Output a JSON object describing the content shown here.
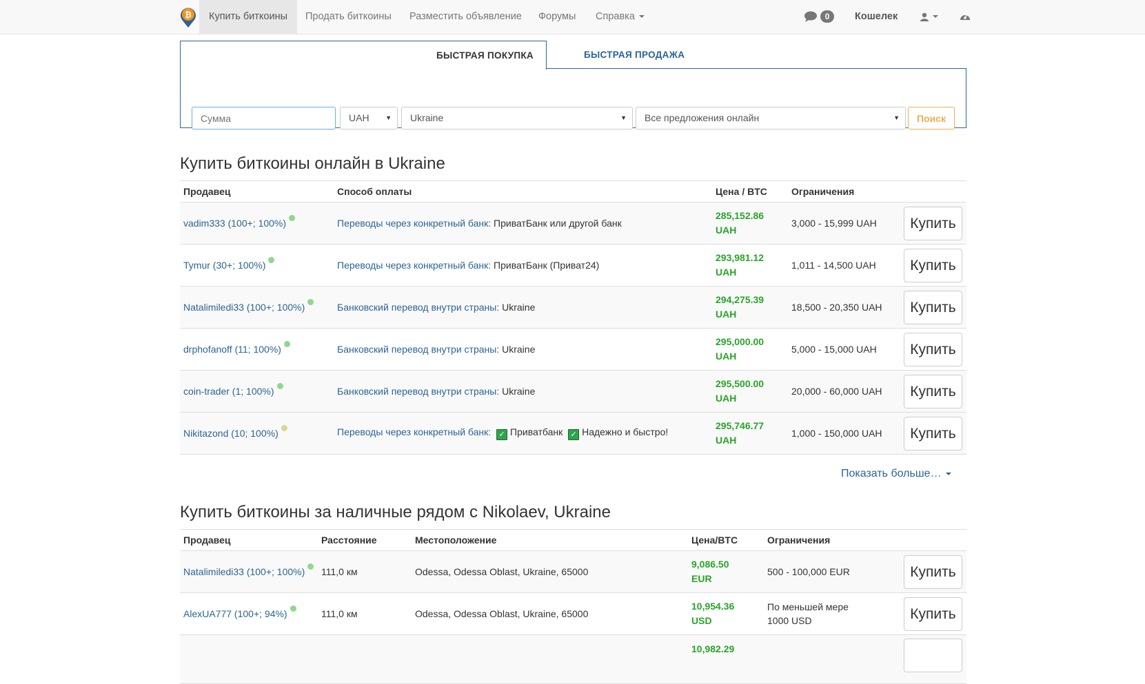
{
  "nav": {
    "items": [
      "Купить биткоины",
      "Продать биткоины",
      "Разместить объявление",
      "Форумы",
      "Справка"
    ],
    "messages_count": "0",
    "wallet": "Кошелек"
  },
  "search": {
    "tabs": [
      "БЫСТРАЯ ПОКУПКА",
      "БЫСТРАЯ ПРОДАЖА"
    ],
    "amount_placeholder": "Сумма",
    "currency": "UAH",
    "country": "Ukraine",
    "offer_type": "Все предложения онлайн",
    "search_button": "Поиск"
  },
  "online_section": {
    "title": "Купить биткоины онлайн в Ukraine",
    "headers": [
      "Продавец",
      "Способ оплаты",
      "Цена / BTC",
      "Ограничения"
    ],
    "rows": [
      {
        "seller": "vadim333 (100+; 100%)",
        "method_link": "Переводы через конкретный банк:",
        "method_text": "ПриватБанк или другой банк",
        "price": "285,152.86",
        "currency": "UAH",
        "limits": "3,000 - 15,999 UAH",
        "buy": "Купить"
      },
      {
        "seller": "Tymur (30+; 100%)",
        "method_link": "Переводы через конкретный банк:",
        "method_text": "ПриватБанк (Приват24)",
        "price": "293,981.12",
        "currency": "UAH",
        "limits": "1,011 - 14,500 UAH",
        "buy": "Купить"
      },
      {
        "seller": "Natalimiledi33 (100+; 100%)",
        "method_link": "Банковский перевод внутри страны:",
        "method_text": "Ukraine",
        "price": "294,275.39",
        "currency": "UAH",
        "limits": "18,500 - 20,350 UAH",
        "buy": "Купить"
      },
      {
        "seller": "drphofanoff (11; 100%)",
        "method_link": "Банковский перевод внутри страны:",
        "method_text": "Ukraine",
        "price": "295,000.00",
        "currency": "UAH",
        "limits": "5,000 - 15,000 UAH",
        "buy": "Купить"
      },
      {
        "seller": "coin-trader (1; 100%)",
        "method_link": "Банковский перевод внутри страны:",
        "method_text": "Ukraine",
        "price": "295,500.00",
        "currency": "UAH",
        "limits": "20,000 - 60,000 UAH",
        "buy": "Купить"
      },
      {
        "seller": "Nikitazond (10; 100%)",
        "method_link": "Переводы через конкретный банк:",
        "method_text_1": "Приватбанк",
        "method_text_2": "Надежно и быстро!",
        "price": "295,746.77",
        "currency": "UAH",
        "limits": "1,000 - 150,000 UAH",
        "buy": "Купить"
      }
    ],
    "show_more": "Показать больше…"
  },
  "cash_section": {
    "title": "Купить биткоины за наличные рядом с Nikolaev, Ukraine",
    "headers": [
      "Продавец",
      "Расстояние",
      "Местоположение",
      "Цена/BTC",
      "Ограничения"
    ],
    "rows": [
      {
        "seller": "Natalimiledi33 (100+; 100%)",
        "distance": "111,0 км",
        "location": "Odessa, Odessa Oblast, Ukraine, 65000",
        "price": "9,086.50",
        "currency": "EUR",
        "limits": "500 - 100,000 EUR",
        "buy": "Купить"
      },
      {
        "seller": "AlexUA777 (100+; 94%)",
        "distance": "111,0 км",
        "location": "Odessa, Odessa Oblast, Ukraine, 65000",
        "price": "10,954.36",
        "currency": "USD",
        "limits_line1": "По меньшей мере",
        "limits_line2": "1000 USD",
        "buy": "Купить"
      },
      {
        "price": "10,982.29"
      }
    ]
  }
}
